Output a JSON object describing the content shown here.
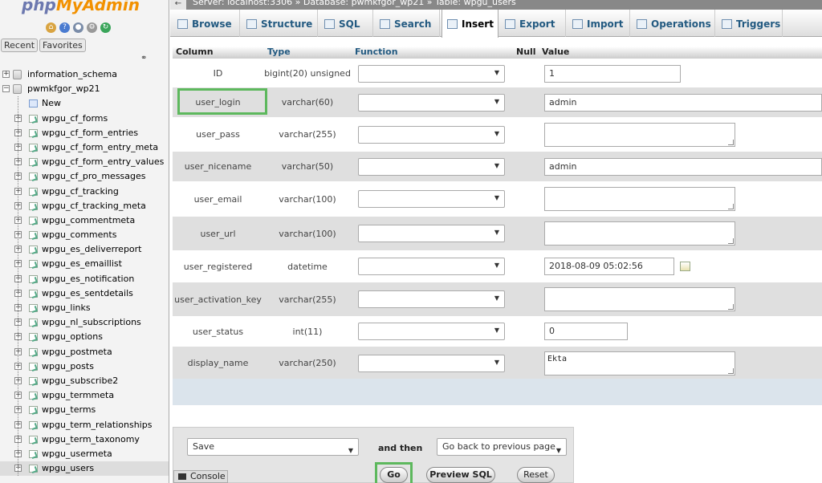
{
  "nav": {
    "logo_php": "php",
    "logo_myadmin": "MyAdmin",
    "icons": [
      "home-icon",
      "info-icon",
      "docs-icon",
      "settings-icon",
      "reload-icon"
    ],
    "recent_label": "Recent",
    "favorites_label": "Favorites",
    "databases": [
      {
        "name": "information_schema",
        "expanded": false
      },
      {
        "name": "pwmkfgor_wp21",
        "expanded": true
      }
    ],
    "new_label": "New",
    "tables": [
      "wpgu_cf_forms",
      "wpgu_cf_form_entries",
      "wpgu_cf_form_entry_meta",
      "wpgu_cf_form_entry_values",
      "wpgu_cf_pro_messages",
      "wpgu_cf_tracking",
      "wpgu_cf_tracking_meta",
      "wpgu_commentmeta",
      "wpgu_comments",
      "wpgu_es_deliverreport",
      "wpgu_es_emaillist",
      "wpgu_es_notification",
      "wpgu_es_sentdetails",
      "wpgu_links",
      "wpgu_nl_subscriptions",
      "wpgu_options",
      "wpgu_postmeta",
      "wpgu_posts",
      "wpgu_subscribe2",
      "wpgu_termmeta",
      "wpgu_terms",
      "wpgu_term_relationships",
      "wpgu_term_taxonomy",
      "wpgu_usermeta",
      "wpgu_users"
    ],
    "active_table": "wpgu_users"
  },
  "breadcrumb": {
    "text": "Server: localhost:3306 » Database: pwmkfgor_wp21 » Table: wpgu_users"
  },
  "tabs": [
    {
      "label": "Browse",
      "icon": "browse-icon"
    },
    {
      "label": "Structure",
      "icon": "structure-icon"
    },
    {
      "label": "SQL",
      "icon": "sql-icon"
    },
    {
      "label": "Search",
      "icon": "search-icon"
    },
    {
      "label": "Insert",
      "icon": "insert-icon",
      "selected": true
    },
    {
      "label": "Export",
      "icon": "export-icon"
    },
    {
      "label": "Import",
      "icon": "import-icon"
    },
    {
      "label": "Operations",
      "icon": "operations-icon"
    },
    {
      "label": "Triggers",
      "icon": "triggers-icon"
    }
  ],
  "insert_table": {
    "headers": {
      "column": "Column",
      "type": "Type",
      "function": "Function",
      "null": "Null",
      "value": "Value"
    },
    "rows": [
      {
        "column": "ID",
        "type": "bigint(20) unsigned",
        "value": "1",
        "input": "text"
      },
      {
        "column": "user_login",
        "type": "varchar(60)",
        "value": "admin",
        "input": "text",
        "highlighted": true
      },
      {
        "column": "user_pass",
        "type": "varchar(255)",
        "value": "",
        "input": "textarea"
      },
      {
        "column": "user_nicename",
        "type": "varchar(50)",
        "value": "admin",
        "input": "text"
      },
      {
        "column": "user_email",
        "type": "varchar(100)",
        "value": "",
        "input": "textarea"
      },
      {
        "column": "user_url",
        "type": "varchar(100)",
        "value": "",
        "input": "textarea"
      },
      {
        "column": "user_registered",
        "type": "datetime",
        "value": "2018-08-09 05:02:56",
        "input": "datetime"
      },
      {
        "column": "user_activation_key",
        "type": "varchar(255)",
        "value": "",
        "input": "textarea"
      },
      {
        "column": "user_status",
        "type": "int(11)",
        "value": "0",
        "input": "text"
      },
      {
        "column": "display_name",
        "type": "varchar(250)",
        "value": "Ekta",
        "input": "textarea"
      }
    ]
  },
  "actions": {
    "save_option": "Save",
    "and_then": "and then",
    "after_option": "Go back to previous page",
    "go": "Go",
    "preview_sql": "Preview SQL",
    "reset": "Reset"
  },
  "console_label": "Console",
  "colors": {
    "highlight": "#5db85d",
    "link": "#235a81"
  }
}
